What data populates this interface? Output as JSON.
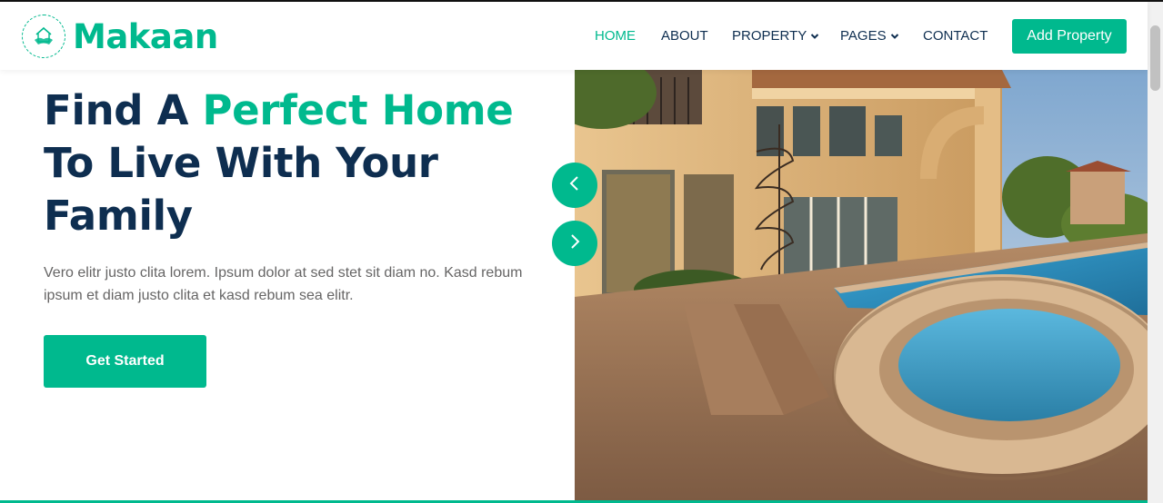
{
  "brand": {
    "name": "Makaan",
    "logo_icon": "handshake-house-icon"
  },
  "nav": {
    "items": [
      {
        "label": "HOME",
        "active": true
      },
      {
        "label": "ABOUT",
        "active": false
      },
      {
        "label": "PROPERTY",
        "active": false,
        "dropdown": true
      },
      {
        "label": "PAGES",
        "active": false,
        "dropdown": true
      },
      {
        "label": "CONTACT",
        "active": false
      }
    ],
    "cta_label": "Add Property"
  },
  "hero": {
    "title_part1": "Find A ",
    "title_accent": "Perfect Home",
    "title_line2": "To Live With Your",
    "title_line3": "Family",
    "text": "Vero elitr justo clita lorem. Ipsum dolor at sed stet sit diam no. Kasd rebum ipsum et diam justo clita et kasd rebum sea elitr.",
    "cta_label": "Get Started",
    "image_alt": "Luxury house with pool"
  },
  "carousel": {
    "prev_icon": "chevron-left-icon",
    "next_icon": "chevron-right-icon"
  },
  "colors": {
    "primary": "#00b98e",
    "dark": "#0e2e50",
    "text": "#666565"
  }
}
